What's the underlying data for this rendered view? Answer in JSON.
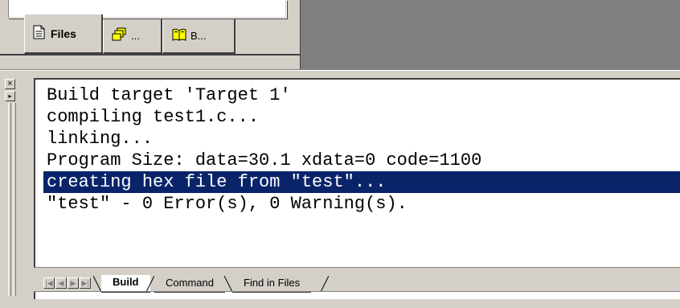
{
  "workspace": {
    "tabs": [
      {
        "label": "Files",
        "icon": "file-icon",
        "active": true
      },
      {
        "label": "...",
        "icon": "project-icon",
        "active": false
      },
      {
        "label": "B...",
        "icon": "book-icon",
        "active": false
      }
    ]
  },
  "output": {
    "close_glyph": "×",
    "pin_glyph": "▸",
    "lines": [
      "Build target 'Target 1'",
      "compiling test1.c...",
      "linking...",
      "Program Size: data=30.1 xdata=0 code=1100",
      "creating hex file from \"test\"...",
      "\"test\" - 0 Error(s), 0 Warning(s)."
    ],
    "selected_line_index": 4,
    "tabs": [
      {
        "label": "Build",
        "active": true
      },
      {
        "label": "Command",
        "active": false
      },
      {
        "label": "Find in Files",
        "active": false
      }
    ],
    "nav_glyphs": [
      "|◀",
      "◀",
      "▶",
      "▶|"
    ]
  },
  "colors": {
    "selection": "#0a246a",
    "face": "#d4d0c8",
    "workspace_bg": "#808080"
  }
}
